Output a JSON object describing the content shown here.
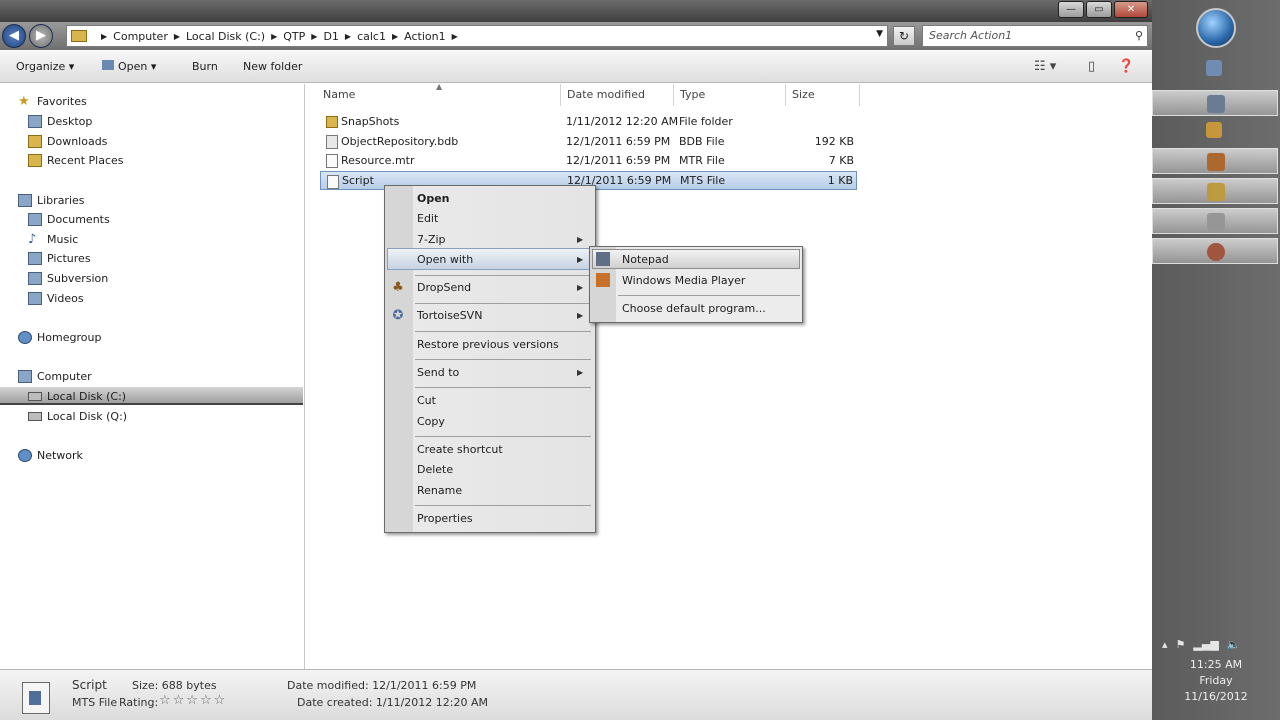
{
  "window": {
    "min_label": "—",
    "max_label": "▭",
    "close_label": "✕"
  },
  "address": {
    "breadcrumbs": [
      "Computer",
      "Local Disk (C:)",
      "QTP",
      "D1",
      "calc1",
      "Action1"
    ],
    "search_placeholder": "Search Action1"
  },
  "toolbar": {
    "organize": "Organize ▾",
    "open": "Open ▾",
    "burn": "Burn",
    "new_folder": "New folder"
  },
  "nav": {
    "favorites": "Favorites",
    "desktop": "Desktop",
    "downloads": "Downloads",
    "recent_places": "Recent Places",
    "libraries": "Libraries",
    "documents": "Documents",
    "music": "Music",
    "pictures": "Pictures",
    "subversion": "Subversion",
    "videos": "Videos",
    "homegroup": "Homegroup",
    "computer": "Computer",
    "local_disk_c": "Local Disk (C:)",
    "local_disk_q": "Local Disk (Q:)",
    "network": "Network"
  },
  "columns": {
    "name": "Name",
    "date_modified": "Date modified",
    "type": "Type",
    "size": "Size"
  },
  "files": [
    {
      "name": "SnapShots",
      "date": "1/11/2012 12:20 AM",
      "type": "File folder",
      "size": ""
    },
    {
      "name": "ObjectRepository.bdb",
      "date": "12/1/2011 6:59 PM",
      "type": "BDB File",
      "size": "192 KB"
    },
    {
      "name": "Resource.mtr",
      "date": "12/1/2011 6:59 PM",
      "type": "MTR File",
      "size": "7 KB"
    },
    {
      "name": "Script",
      "date": "12/1/2011 6:59 PM",
      "type": "MTS File",
      "size": "1 KB"
    }
  ],
  "context_menu": {
    "open": "Open",
    "edit": "Edit",
    "sevenzip": "7-Zip",
    "open_with": "Open with",
    "dropsend": "DropSend",
    "tortoisesvn": "TortoiseSVN",
    "restore": "Restore previous versions",
    "send_to": "Send to",
    "cut": "Cut",
    "copy": "Copy",
    "create_shortcut": "Create shortcut",
    "delete": "Delete",
    "rename": "Rename",
    "properties": "Properties"
  },
  "submenu": {
    "notepad": "Notepad",
    "wmp": "Windows Media Player",
    "choose_default": "Choose default program..."
  },
  "details": {
    "name": "Script",
    "filetype": "MTS File",
    "size": "Size: 688 bytes",
    "rating_label": "Rating:",
    "stars": "☆☆☆☆☆",
    "date_modified": "Date modified: 12/1/2011 6:59 PM",
    "date_created": "Date created: 1/11/2012 12:20 AM"
  },
  "clock": {
    "time": "11:25 AM",
    "day": "Friday",
    "date": "11/16/2012"
  }
}
